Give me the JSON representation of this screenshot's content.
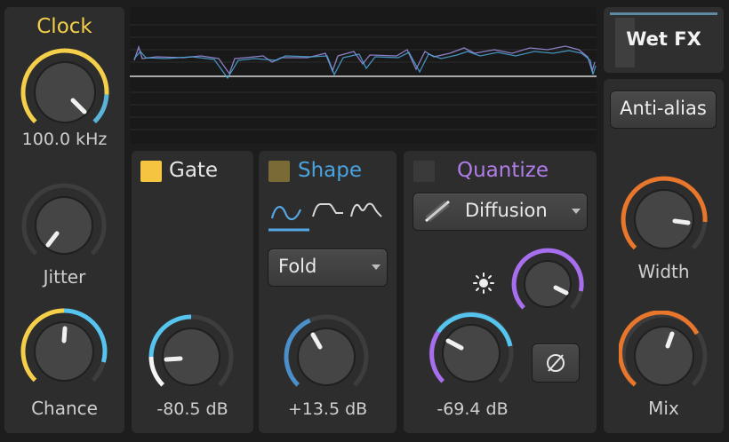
{
  "clock": {
    "title": "Clock",
    "value": "100.0 kHz",
    "jitter_label": "Jitter",
    "chance_label": "Chance"
  },
  "gate": {
    "title": "Gate",
    "value": "-80.5 dB"
  },
  "shape": {
    "title": "Shape",
    "mode": "Fold",
    "value": "+13.5 dB",
    "waveforms": [
      "sine-wave-icon",
      "clip-wave-icon",
      "fold-wave-icon"
    ]
  },
  "quantize": {
    "title": "Quantize",
    "mode": "Diffusion",
    "value": "-69.4 dB"
  },
  "output": {
    "wet_label": "Wet FX",
    "antialias_label": "Anti-alias",
    "width_label": "Width",
    "mix_label": "Mix"
  },
  "colors": {
    "clock": "#f5cf4a",
    "gate": "#f5c542",
    "shape": "#4aa3df",
    "quantize": "#b07de8",
    "accent_orange": "#e8762b",
    "accent_blue": "#55c4ee"
  }
}
